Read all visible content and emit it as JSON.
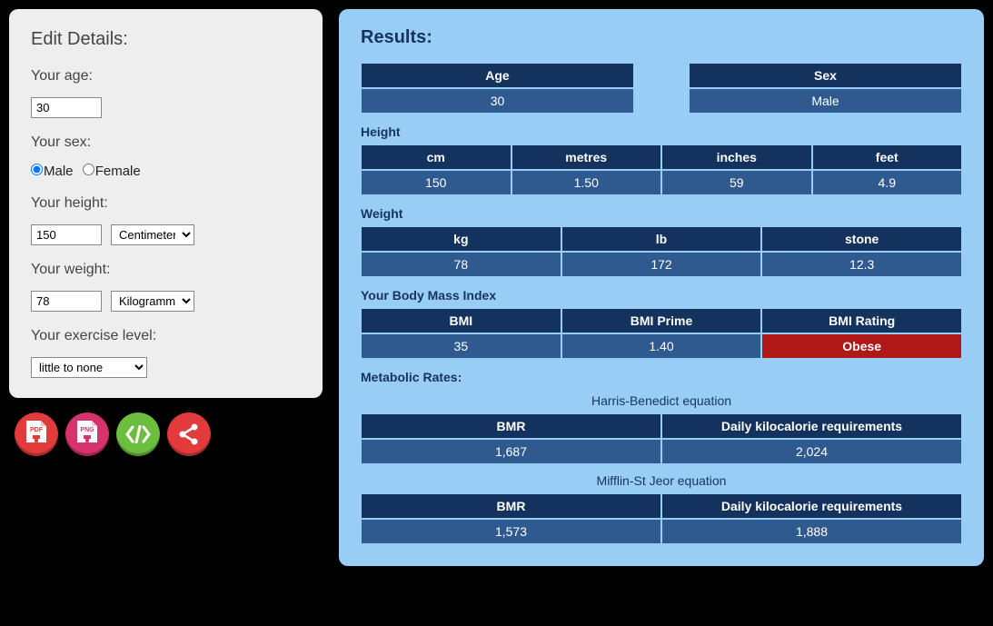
{
  "edit": {
    "title": "Edit Details:",
    "age_label": "Your age:",
    "age_value": "30",
    "sex_label": "Your sex:",
    "sex_male": "Male",
    "sex_female": "Female",
    "height_label": "Your height:",
    "height_value": "150",
    "height_unit": "Centimeters",
    "weight_label": "Your weight:",
    "weight_value": "78",
    "weight_unit": "Kilogrammes",
    "exercise_label": "Your exercise level:",
    "exercise_value": "little to none"
  },
  "results": {
    "title": "Results:",
    "age_hdr": "Age",
    "age_val": "30",
    "sex_hdr": "Sex",
    "sex_val": "Male",
    "height_label": "Height",
    "height": {
      "cm_hdr": "cm",
      "cm_val": "150",
      "m_hdr": "metres",
      "m_val": "1.50",
      "in_hdr": "inches",
      "in_val": "59",
      "ft_hdr": "feet",
      "ft_val": "4.9"
    },
    "weight_label": "Weight",
    "weight": {
      "kg_hdr": "kg",
      "kg_val": "78",
      "lb_hdr": "lb",
      "lb_val": "172",
      "st_hdr": "stone",
      "st_val": "12.3"
    },
    "bmi_label": "Your Body Mass Index",
    "bmi": {
      "bmi_hdr": "BMI",
      "bmi_val": "35",
      "prime_hdr": "BMI Prime",
      "prime_val": "1.40",
      "rating_hdr": "BMI Rating",
      "rating_val": "Obese"
    },
    "metabolic_label": "Metabolic Rates:",
    "hb_caption": "Harris-Benedict equation",
    "msj_caption": "Mifflin-St Jeor equation",
    "rate_bmr_hdr": "BMR",
    "rate_kcal_hdr": "Daily kilocalorie requirements",
    "hb": {
      "bmr": "1,687",
      "kcal": "2,024"
    },
    "msj": {
      "bmr": "1,573",
      "kcal": "1,888"
    }
  },
  "icons": {
    "pdf": "PDF",
    "png": "PNG"
  }
}
